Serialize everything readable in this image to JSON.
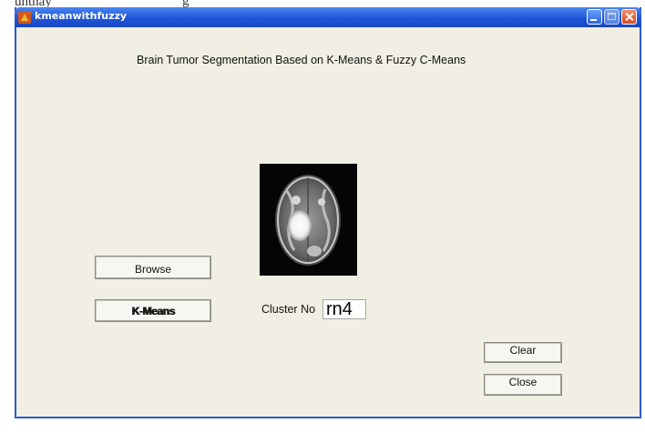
{
  "scan_artifacts": {
    "left": "unthay",
    "middle": "g"
  },
  "window": {
    "title": "kmeanwithfuzzy"
  },
  "heading": "Brain Tumor Segmentation Based on K-Means & Fuzzy C-Means",
  "buttons": {
    "browse": "Browse",
    "kmeans": "K-Means",
    "clear": "Clear",
    "close": "Close"
  },
  "cluster": {
    "label": "Cluster No",
    "value": "rn4"
  },
  "icons": {
    "app": "matlab-icon",
    "minimize": "minimize-icon",
    "maximize": "maximize-icon",
    "close": "close-icon"
  },
  "colors": {
    "titlebar": "#1f55d6",
    "window_bg": "#f1efe3"
  }
}
